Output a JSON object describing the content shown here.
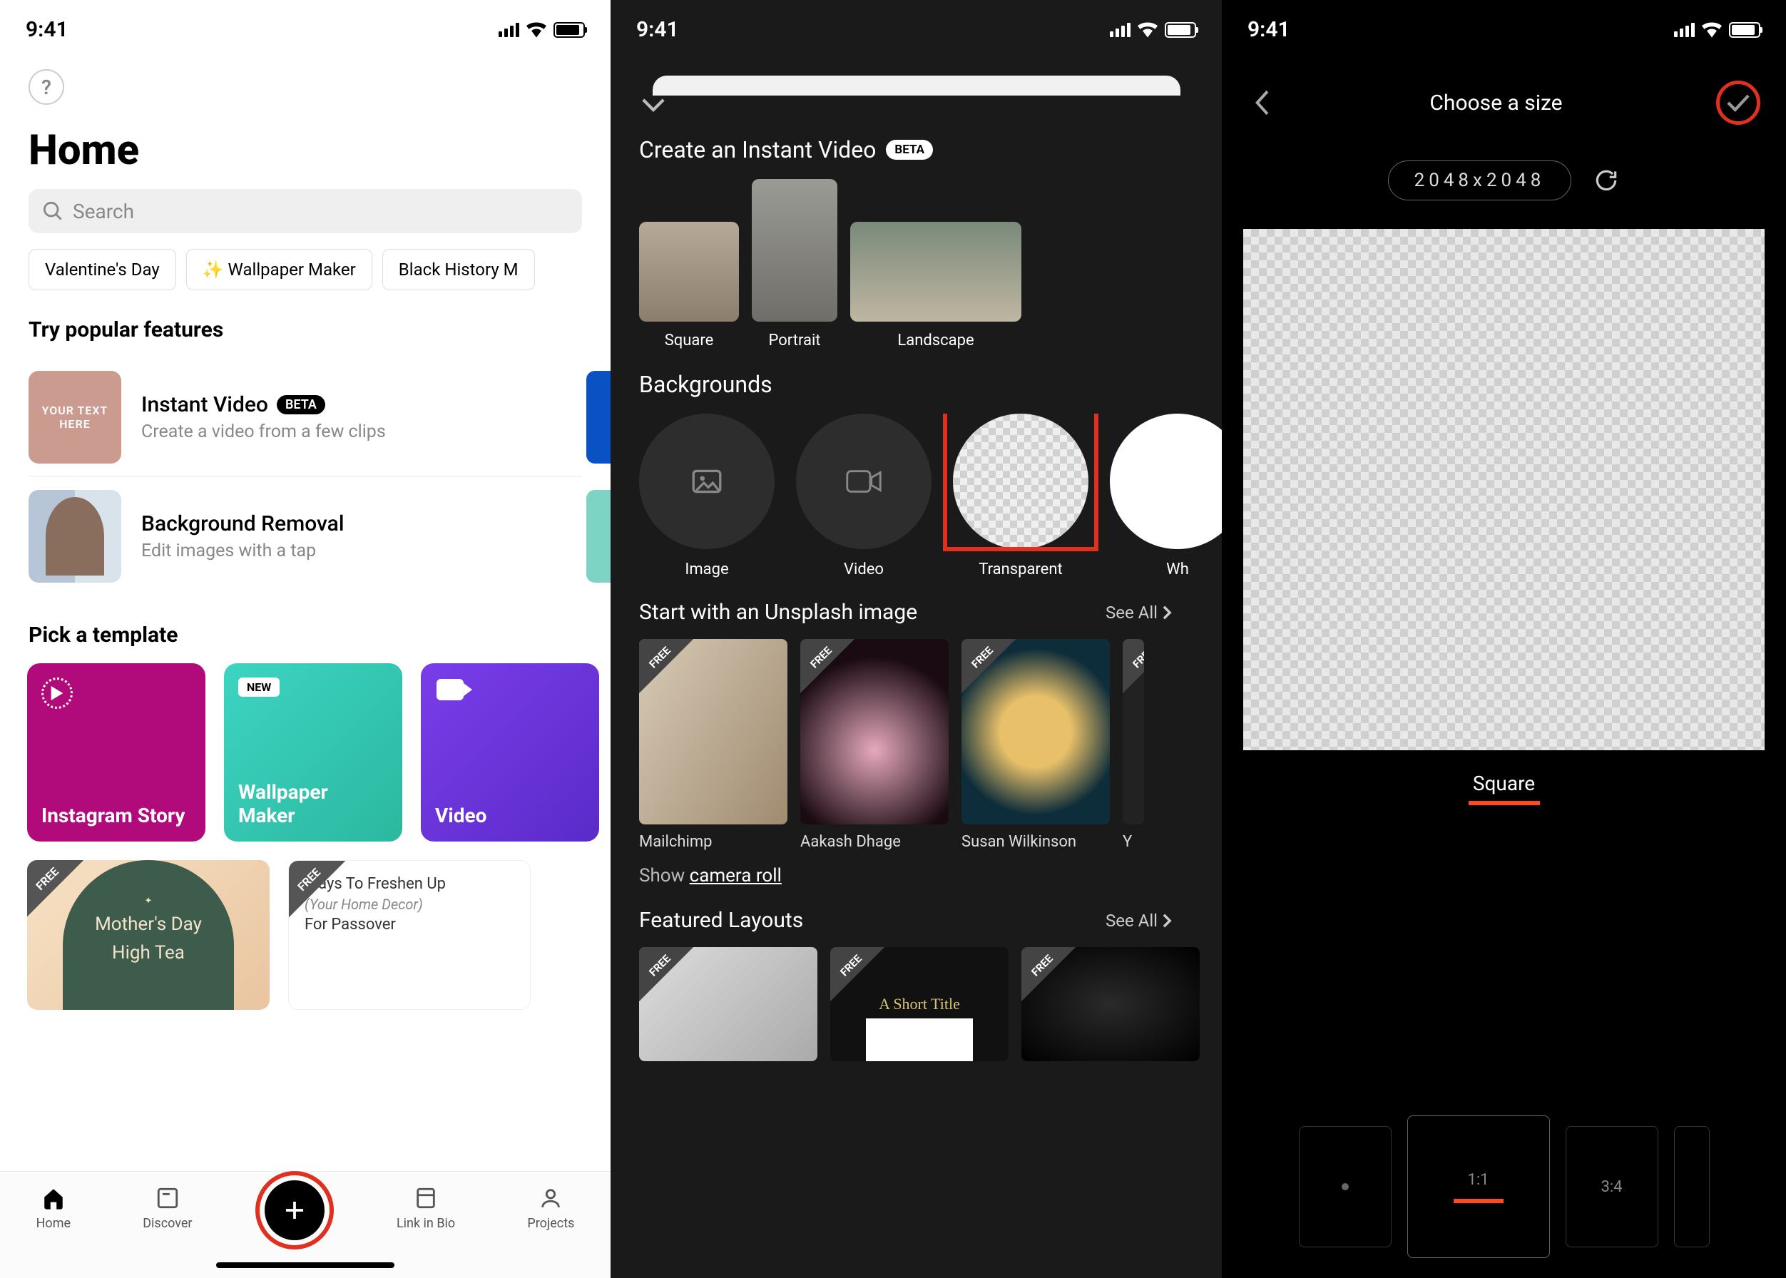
{
  "time": "9:41",
  "phone1": {
    "title": "Home",
    "searchPlaceholder": "Search",
    "chips": [
      "Valentine's Day",
      "✨ Wallpaper Maker",
      "Black History M"
    ],
    "popularHeader": "Try popular features",
    "features": [
      {
        "thumbText": "YOUR TEXT HERE",
        "title": "Instant Video",
        "badge": "BETA",
        "sub": "Create a video from a few clips"
      },
      {
        "title": "Background Removal",
        "sub": "Edit images with a tap"
      }
    ],
    "templateHeader": "Pick a template",
    "templates": [
      {
        "label": "Instagram Story"
      },
      {
        "label": "Wallpaper Maker",
        "badge": "NEW"
      },
      {
        "label": "Video"
      }
    ],
    "cards": [
      {
        "free": "FREE",
        "line1": "Mother's Day",
        "line2": "High Tea"
      },
      {
        "free": "FREE",
        "line1": "Ways To Freshen Up",
        "line2": "(Your Home Decor)",
        "line3": "For Passover"
      }
    ],
    "tabs": [
      "Home",
      "Discover",
      "",
      "Link in Bio",
      "Projects"
    ]
  },
  "phone2": {
    "instantHeader": "Create an Instant Video",
    "instantBadge": "BETA",
    "videoShapes": [
      "Square",
      "Portrait",
      "Landscape"
    ],
    "bgHeader": "Backgrounds",
    "backgrounds": [
      "Image",
      "Video",
      "Transparent",
      "Wh"
    ],
    "unsplashHeader": "Start with an Unsplash image",
    "seeAll": "See All",
    "unsplash": [
      {
        "free": "FREE",
        "name": "Mailchimp"
      },
      {
        "free": "FREE",
        "name": "Aakash Dhage"
      },
      {
        "free": "FREE",
        "name": "Susan Wilkinson"
      },
      {
        "free": "FREE",
        "name": "Y"
      }
    ],
    "showPrefix": "Show ",
    "showLink": "camera roll",
    "layoutsHeader": "Featured Layouts",
    "layouts": [
      "FREE",
      "FREE",
      "FREE"
    ]
  },
  "phone3": {
    "title": "Choose a size",
    "dims": "2048x2048",
    "shape": "Square",
    "ratios": [
      "",
      "1:1",
      "3:4"
    ]
  }
}
